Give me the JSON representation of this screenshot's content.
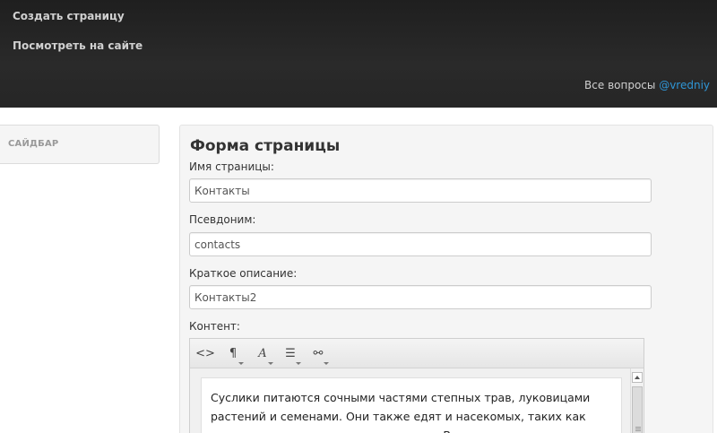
{
  "header": {
    "nav": [
      {
        "label": "Создать страницу"
      },
      {
        "label": "Посмотреть на сайте"
      }
    ],
    "questions_text": "Все вопросы ",
    "questions_handle": "@vredniy"
  },
  "sidebar": {
    "title": "САЙДБАР"
  },
  "form": {
    "title": "Форма страницы",
    "fields": {
      "name": {
        "label": "Имя страницы:",
        "value": "Контакты"
      },
      "alias": {
        "label": "Псевдоним:",
        "value": "contacts"
      },
      "description": {
        "label": "Краткое описание:",
        "value": "Контакты2"
      }
    },
    "content": {
      "label": "Контент:",
      "toolbar": [
        {
          "glyph": "<>",
          "icon": "html-code-icon"
        },
        {
          "glyph": "¶",
          "icon": "paragraph-format-icon"
        },
        {
          "glyph": "A",
          "icon": "font-style-icon"
        },
        {
          "glyph": "☰",
          "icon": "list-icon"
        },
        {
          "glyph": "⚯",
          "icon": "link-icon"
        }
      ],
      "text": "Суслики питаются сочными частями степных трав, луковицами растений и семенами. Они также едят и насекомых, таких как саранча, кузнечики, жуки и гусеницы. В засушливое время этот"
    }
  }
}
